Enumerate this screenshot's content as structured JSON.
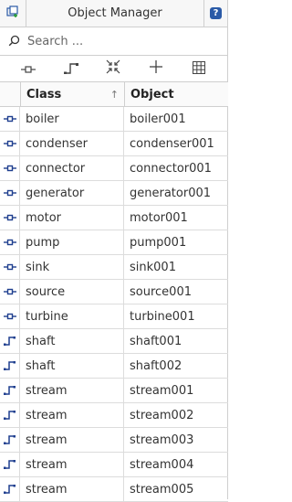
{
  "titlebar": {
    "title": "Object Manager",
    "left_icon": "add-panel-icon",
    "right_icon": "help-icon",
    "help_label": "?"
  },
  "search": {
    "placeholder": "Search ..."
  },
  "toolbar": {
    "buttons": [
      {
        "name": "component-filter-icon"
      },
      {
        "name": "connection-filter-icon"
      },
      {
        "name": "collapse-icon"
      },
      {
        "name": "add-icon"
      },
      {
        "name": "grid-icon"
      }
    ]
  },
  "table": {
    "headers": {
      "class": "Class",
      "object": "Object"
    },
    "sort_indicator": "↑",
    "rows": [
      {
        "type": "component",
        "class": "boiler",
        "object": "boiler001"
      },
      {
        "type": "component",
        "class": "condenser",
        "object": "condenser001"
      },
      {
        "type": "component",
        "class": "connector",
        "object": "connector001"
      },
      {
        "type": "component",
        "class": "generator",
        "object": "generator001"
      },
      {
        "type": "component",
        "class": "motor",
        "object": "motor001"
      },
      {
        "type": "component",
        "class": "pump",
        "object": "pump001"
      },
      {
        "type": "component",
        "class": "sink",
        "object": "sink001"
      },
      {
        "type": "component",
        "class": "source",
        "object": "source001"
      },
      {
        "type": "component",
        "class": "turbine",
        "object": "turbine001"
      },
      {
        "type": "connection",
        "class": "shaft",
        "object": "shaft001"
      },
      {
        "type": "connection",
        "class": "shaft",
        "object": "shaft002"
      },
      {
        "type": "connection",
        "class": "stream",
        "object": "stream001"
      },
      {
        "type": "connection",
        "class": "stream",
        "object": "stream002"
      },
      {
        "type": "connection",
        "class": "stream",
        "object": "stream003"
      },
      {
        "type": "connection",
        "class": "stream",
        "object": "stream004"
      },
      {
        "type": "connection",
        "class": "stream",
        "object": "stream005"
      }
    ]
  },
  "colors": {
    "accent": "#2a5aa7",
    "icon": "#1f3f8f"
  }
}
